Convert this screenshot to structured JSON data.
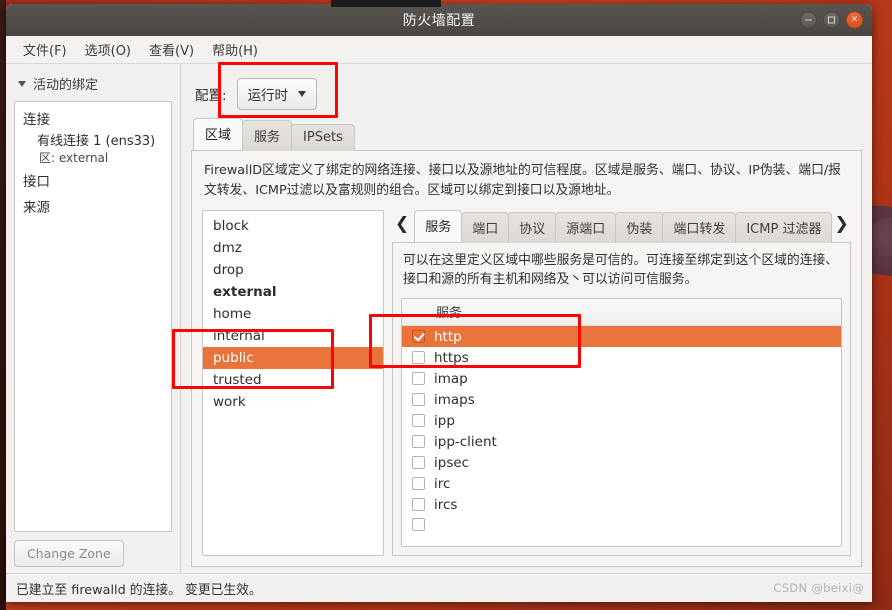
{
  "window": {
    "title": "防火墙配置",
    "controls": [
      {
        "name": "minimize",
        "glyph": "min"
      },
      {
        "name": "maximize",
        "glyph": "max"
      },
      {
        "name": "close",
        "glyph": "×"
      }
    ]
  },
  "menubar": {
    "items": [
      {
        "label": "文件(F)"
      },
      {
        "label": "选项(O)"
      },
      {
        "label": "查看(V)"
      },
      {
        "label": "帮助(H)"
      }
    ]
  },
  "sidebar": {
    "header": "活动的绑定",
    "chevron_icon": "chevron-down-icon",
    "groups": [
      {
        "label": "连接",
        "child": "有线连接 1 (ens33)",
        "sub": "区: external"
      },
      {
        "label": "接口"
      },
      {
        "label": "来源"
      }
    ],
    "change_zone_button": "Change Zone"
  },
  "config": {
    "label": "配置:",
    "selected": "运行时",
    "caret_icon": "chevron-down-icon"
  },
  "main_tabs": [
    {
      "label": "区域",
      "active": true
    },
    {
      "label": "服务",
      "active": false
    },
    {
      "label": "IPSets",
      "active": false
    }
  ],
  "zone_description": "FirewallD区域定义了绑定的网络连接、接口以及源地址的可信程度。区域是服务、端口、协议、IP伪装、端口/报文转发、ICMP过滤以及富规则的组合。区域可以绑定到接口以及源地址。",
  "zones": [
    {
      "name": "block",
      "bold": false,
      "selected": false
    },
    {
      "name": "dmz",
      "bold": false,
      "selected": false
    },
    {
      "name": "drop",
      "bold": false,
      "selected": false
    },
    {
      "name": "external",
      "bold": true,
      "selected": false
    },
    {
      "name": "home",
      "bold": false,
      "selected": false
    },
    {
      "name": "internal",
      "bold": false,
      "selected": false
    },
    {
      "name": "public",
      "bold": false,
      "selected": true
    },
    {
      "name": "trusted",
      "bold": false,
      "selected": false
    },
    {
      "name": "work",
      "bold": false,
      "selected": false
    }
  ],
  "inner_tabs": {
    "prev_icon": "chevron-left-icon",
    "next_icon": "chevron-right-icon",
    "items": [
      {
        "label": "服务",
        "active": true
      },
      {
        "label": "端口",
        "active": false
      },
      {
        "label": "协议",
        "active": false
      },
      {
        "label": "源端口",
        "active": false
      },
      {
        "label": "伪装",
        "active": false
      },
      {
        "label": "端口转发",
        "active": false
      },
      {
        "label": "ICMP 过滤器",
        "active": false
      }
    ]
  },
  "services_description": "可以在这里定义区域中哪些服务是可信的。可连接至绑定到这个区域的连接、接口和源的所有主机和网络及丶可以访问可信服务。",
  "services": {
    "column_header": "服务",
    "rows": [
      {
        "name": "http",
        "checked": true,
        "selected": true
      },
      {
        "name": "https",
        "checked": false,
        "selected": false
      },
      {
        "name": "imap",
        "checked": false,
        "selected": false
      },
      {
        "name": "imaps",
        "checked": false,
        "selected": false
      },
      {
        "name": "ipp",
        "checked": false,
        "selected": false
      },
      {
        "name": "ipp-client",
        "checked": false,
        "selected": false
      },
      {
        "name": "ipsec",
        "checked": false,
        "selected": false
      },
      {
        "name": "irc",
        "checked": false,
        "selected": false
      },
      {
        "name": "ircs",
        "checked": false,
        "selected": false
      }
    ]
  },
  "statusbar": {
    "text": "已建立至 firewalld 的连接。  变更已生效。",
    "watermark": "CSDN @beixi@"
  },
  "annotations": {
    "accent_color": "#fb0606",
    "selection_color": "#e8743c"
  }
}
